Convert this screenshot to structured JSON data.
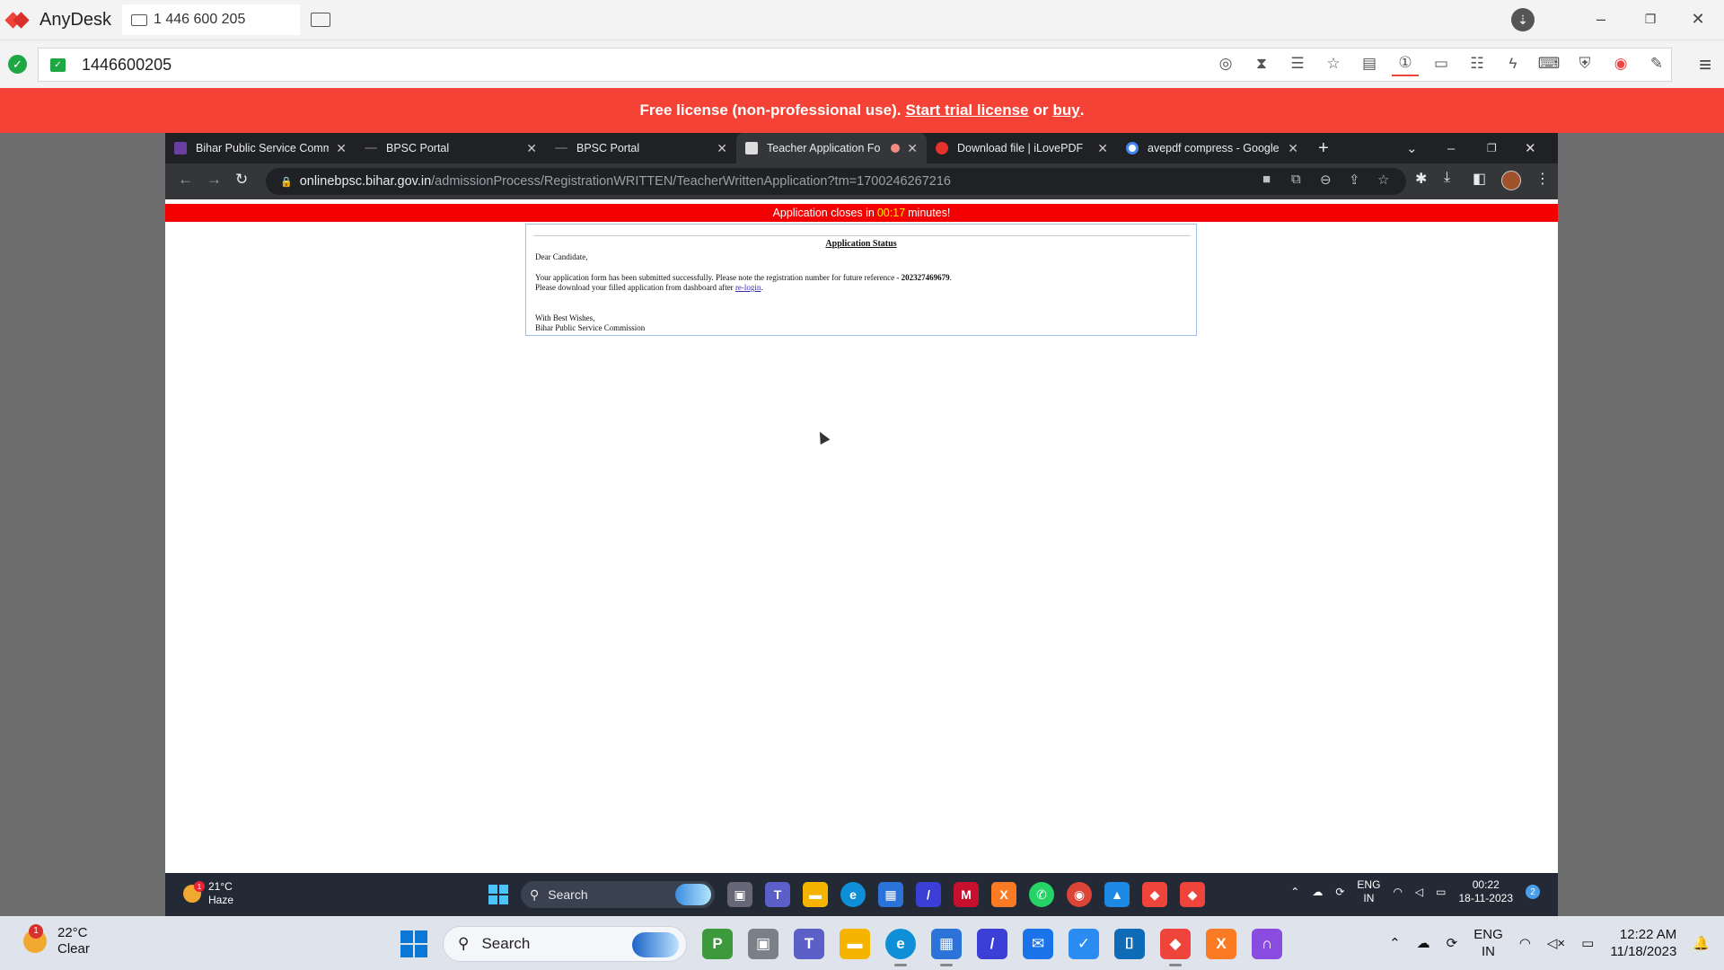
{
  "anydesk": {
    "brand": "AnyDesk",
    "session_tab": "1 446 600 205",
    "address_value": "1446600205",
    "window_controls": [
      "minimize",
      "restore",
      "close"
    ],
    "toolbar_icons": [
      "privacy-icon",
      "hourglass-icon",
      "database-icon",
      "star-icon",
      "file-transfer-icon",
      "display-one-icon",
      "monitor-icon",
      "chat-icon",
      "lightning-icon",
      "keyboard-icon",
      "shield-icon",
      "record-icon",
      "pen-icon"
    ]
  },
  "license_banner": {
    "prefix": "Free license (non-professional use).",
    "trial_link": "Start trial license",
    "middle": "or",
    "buy_link": "buy",
    "suffix": "."
  },
  "browser": {
    "tabs": [
      {
        "title": "Bihar Public Service Comm",
        "favicon_color": "#6b3fa0"
      },
      {
        "title": "BPSC Portal",
        "favicon_color": "#888888"
      },
      {
        "title": "BPSC Portal",
        "favicon_color": "#888888"
      },
      {
        "title": "Teacher Application Fo",
        "favicon_color": "#dddddd"
      },
      {
        "title": "Download file | iLovePDF",
        "favicon_color": "#e5322d"
      },
      {
        "title": "avepdf compress - Google",
        "favicon_color": "#4285f4"
      }
    ],
    "active_tab_index": 3,
    "url_host": "onlinebpsc.bihar.gov.in",
    "url_path": "/admissionProcess/RegistrationWRITTEN/TeacherWrittenApplication?tm=1700246267216"
  },
  "page": {
    "alert": {
      "prefix": "Application closes in",
      "time": "00:17",
      "suffix": "minutes!"
    },
    "status": {
      "heading": "Application Status",
      "greeting": "Dear Candidate,",
      "line1_text": "Your application form has been submitted successfully. Please note the registration number for future reference -",
      "registration_number": "202327469679",
      "line1_end": ".",
      "line2_text": "Please download your filled application from dashboard after",
      "relogin_link": "re-login",
      "line2_end": ".",
      "closing": "With Best Wishes,",
      "signature": "Bihar Public Service Commission"
    }
  },
  "remote_taskbar": {
    "weather_temp": "21°C",
    "weather_desc": "Haze",
    "weather_badge": "1",
    "search_label": "Search",
    "language": "ENG",
    "region": "IN",
    "time": "00:22",
    "date": "18-11-2023",
    "notification_count": "2"
  },
  "local_taskbar": {
    "weather_temp": "22°C",
    "weather_desc": "Clear",
    "weather_badge": "1",
    "search_label": "Search",
    "language": "ENG",
    "region": "IN",
    "time": "12:22 AM",
    "date": "11/18/2023"
  }
}
